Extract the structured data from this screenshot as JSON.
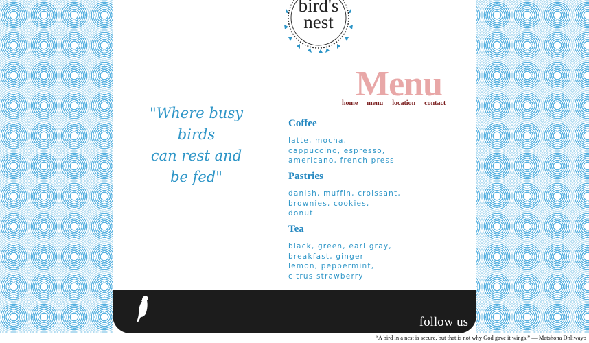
{
  "logo": {
    "line1": "bird's",
    "line2": "nest"
  },
  "header": {
    "title": "Menu",
    "nav": [
      "home",
      "menu",
      "location",
      "contact"
    ]
  },
  "tagline": "\"Where busy birds\ncan rest and\nbe fed\"",
  "menu": {
    "sections": [
      {
        "title": "Coffee",
        "items": "latte, mocha,\ncappuccino, espresso,\namericano, french press"
      },
      {
        "title": "Pastries",
        "items": "danish, muffin, croissant,\nbrownies, cookies,\ndonut"
      },
      {
        "title": "Tea",
        "items": "black, green, earl gray,\nbreakfast, ginger\nlemon, peppermint,\ncitrus strawberry"
      }
    ]
  },
  "footer": {
    "follow_label": "follow us",
    "quote": "“A bird in a nest is secure, but that is not why God gave it wings.” — Matshona Dhliwayo"
  },
  "colors": {
    "pattern_blue": "#57b1e0",
    "menu_title_pink": "#e8a7a7",
    "nav_maroon": "#7a1e1e",
    "text_blue": "#2d95c7",
    "footer_black": "#1c1c1c"
  },
  "icons": [
    "bird-icon",
    "logo-badge-icon"
  ]
}
